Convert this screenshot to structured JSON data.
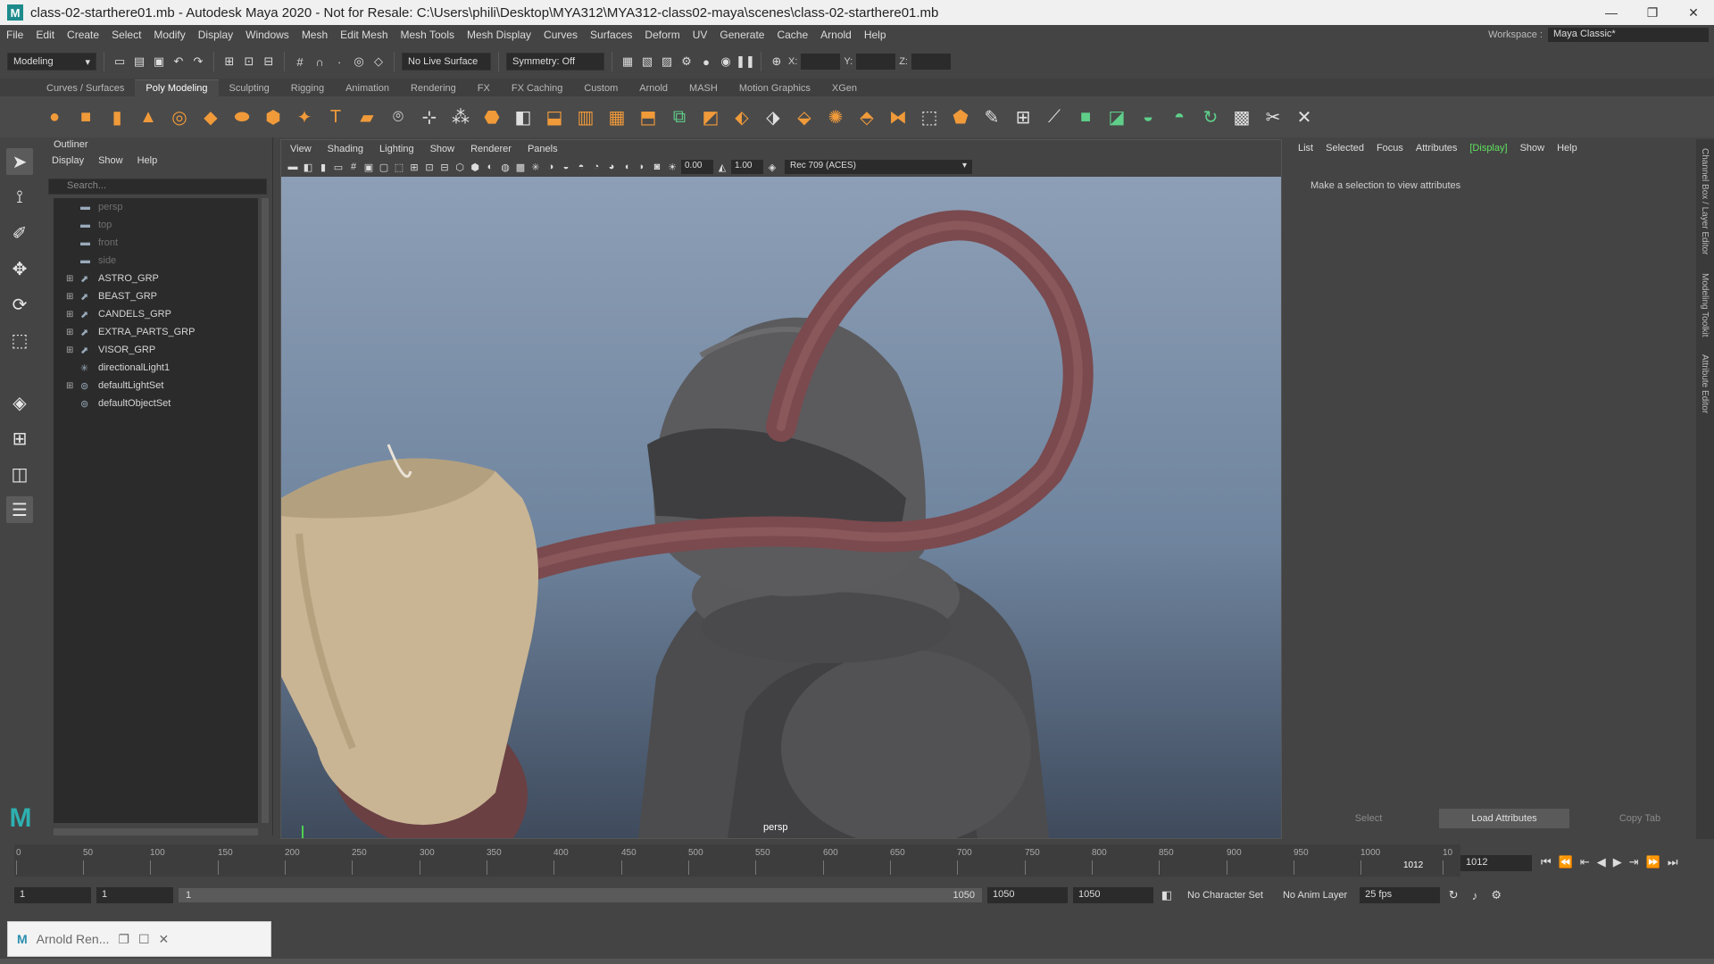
{
  "titlebar": {
    "title": "class-02-starthere01.mb - Autodesk Maya 2020 - Not for Resale: C:\\Users\\phili\\Desktop\\MYA312\\MYA312-class02-maya\\scenes\\class-02-starthere01.mb",
    "app_icon": "M",
    "minimize": "—",
    "maximize": "❐",
    "close": "✕"
  },
  "menubar": {
    "items": [
      "File",
      "Edit",
      "Create",
      "Select",
      "Modify",
      "Display",
      "Windows",
      "Mesh",
      "Edit Mesh",
      "Mesh Tools",
      "Mesh Display",
      "Curves",
      "Surfaces",
      "Deform",
      "UV",
      "Generate",
      "Cache",
      "Arnold",
      "Help"
    ],
    "workspace_label": "Workspace :",
    "workspace_value": "Maya Classic*"
  },
  "statusline": {
    "mode": "Modeling",
    "live_surface": "No Live Surface",
    "symmetry": "Symmetry: Off",
    "x_label": "X:",
    "y_label": "Y:",
    "z_label": "Z:"
  },
  "shelf": {
    "tabs": [
      "Curves / Surfaces",
      "Poly Modeling",
      "Sculpting",
      "Rigging",
      "Animation",
      "Rendering",
      "FX",
      "FX Caching",
      "Custom",
      "Arnold",
      "MASH",
      "Motion Graphics",
      "XGen"
    ],
    "active_tab": "Poly Modeling"
  },
  "outliner": {
    "title": "Outliner",
    "menu": [
      "Display",
      "Show",
      "Help"
    ],
    "search_placeholder": "Search...",
    "items": [
      {
        "label": "persp",
        "dim": true,
        "expandable": false
      },
      {
        "label": "top",
        "dim": true,
        "expandable": false
      },
      {
        "label": "front",
        "dim": true,
        "expandable": false
      },
      {
        "label": "side",
        "dim": true,
        "expandable": false
      },
      {
        "label": "ASTRO_GRP",
        "dim": false,
        "expandable": true
      },
      {
        "label": "BEAST_GRP",
        "dim": false,
        "expandable": true
      },
      {
        "label": "CANDELS_GRP",
        "dim": false,
        "expandable": true
      },
      {
        "label": "EXTRA_PARTS_GRP",
        "dim": false,
        "expandable": true
      },
      {
        "label": "VISOR_GRP",
        "dim": false,
        "expandable": true
      },
      {
        "label": "directionalLight1",
        "dim": false,
        "expandable": false
      },
      {
        "label": "defaultLightSet",
        "dim": false,
        "expandable": true
      },
      {
        "label": "defaultObjectSet",
        "dim": false,
        "expandable": false
      }
    ]
  },
  "viewport": {
    "menu": [
      "View",
      "Shading",
      "Lighting",
      "Show",
      "Renderer",
      "Panels"
    ],
    "exposure": "0.00",
    "gamma": "1.00",
    "colorspace": "Rec 709 (ACES)",
    "camera": "persp"
  },
  "attribute_editor": {
    "menu": [
      "List",
      "Selected",
      "Focus",
      "Attributes",
      "[Display]",
      "Show",
      "Help"
    ],
    "message": "Make a selection to view attributes",
    "buttons": [
      "Select",
      "Load Attributes",
      "Copy Tab"
    ]
  },
  "side_tabs": [
    "Channel Box / Layer Editor",
    "Modeling Toolkit",
    "Attribute Editor"
  ],
  "timeslider": {
    "ticks": [
      "0",
      "50",
      "100",
      "150",
      "200",
      "250",
      "300",
      "350",
      "400",
      "450",
      "500",
      "550",
      "600",
      "650",
      "700",
      "750",
      "800",
      "850",
      "900",
      "950",
      "1000",
      "10"
    ],
    "current_frame": "1012",
    "current_frame_field": "1012"
  },
  "rangeslider": {
    "start": "1",
    "start_range": "1",
    "bar_start": "1",
    "bar_end": "1050",
    "end_range": "1050",
    "end": "1050",
    "character_set": "No Character Set",
    "anim_layer": "No Anim Layer",
    "fps": "25 fps"
  },
  "taskbar": {
    "app_label": "Arnold Ren..."
  }
}
